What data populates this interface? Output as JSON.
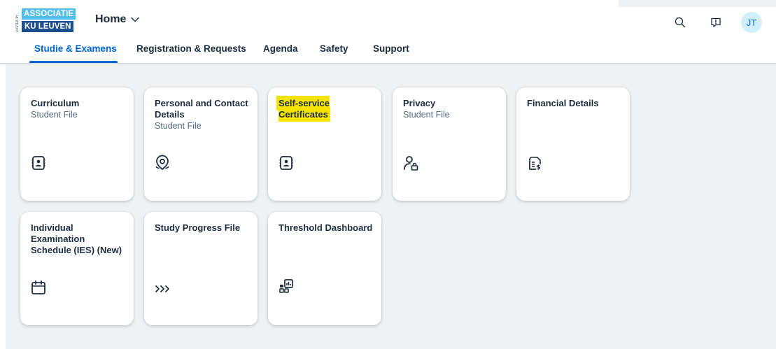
{
  "shell": {
    "logo": {
      "hosted_text": "HOSTED BY",
      "line1": "ASSOCIATIE",
      "line2": "KU LEUVEN"
    },
    "home_menu": {
      "label": "Home",
      "icon": "chevron-down-icon"
    },
    "actions": {
      "search_icon": "search-icon",
      "feedback_icon": "feedback-icon",
      "avatar_initials": "JT"
    }
  },
  "tabs": [
    {
      "label": "Studie & Examens",
      "active": true
    },
    {
      "label": "Registration & Requests",
      "active": false
    },
    {
      "label": "Agenda",
      "active": false
    },
    {
      "label": "Safety",
      "active": false
    },
    {
      "label": "Support",
      "active": false
    }
  ],
  "tiles": [
    {
      "title": "Curriculum",
      "subtitle": "Student File",
      "icon": "contact-card-icon"
    },
    {
      "title": "Personal and Contact Details",
      "subtitle": "Student File",
      "icon": "location-pin-icon"
    },
    {
      "title": "Self-service Certificates",
      "subtitle": "",
      "icon": "contact-card-icon",
      "highlighted": true
    },
    {
      "title": "Privacy",
      "subtitle": "Student File",
      "icon": "user-lock-icon"
    },
    {
      "title": "Financial Details",
      "subtitle": "",
      "icon": "documents-dollar-icon"
    },
    {
      "title": "Individual Examination Schedule (IES) (New)",
      "subtitle": "",
      "icon": "calendar-icon"
    },
    {
      "title": "Study Progress File",
      "subtitle": "",
      "icon": "triple-chevron-right-icon"
    },
    {
      "title": "Threshold Dashboard",
      "subtitle": "",
      "icon": "dashboard-icon"
    }
  ],
  "colors": {
    "accent": "#0064d9",
    "text": "#1d2d3e",
    "subtext": "#556b82",
    "content_bg": "#eff1f2",
    "highlight": "#f5e400",
    "logo_light_blue": "#52bdec",
    "logo_dark_blue": "#1d4f91",
    "avatar_bg": "#d1efff"
  }
}
